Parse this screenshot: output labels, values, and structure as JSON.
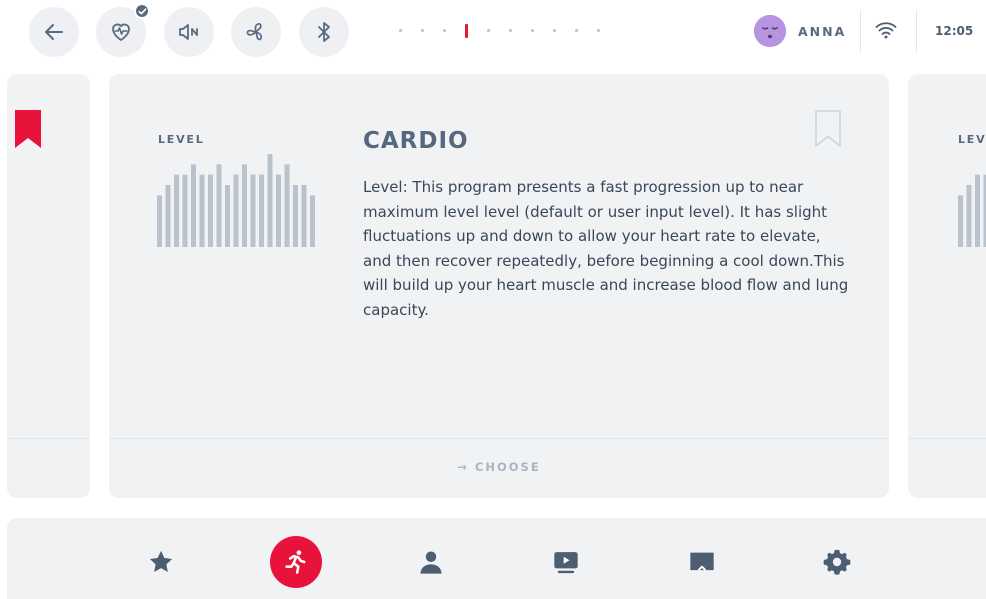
{
  "topbar": {
    "icons": [
      "back-arrow-icon",
      "heart-rate-icon",
      "sound-off-icon",
      "fan-icon",
      "bluetooth-icon"
    ],
    "heart_rate_connected": true,
    "page_indicator": {
      "total": 10,
      "current": 4
    },
    "user": {
      "name": "ANNA",
      "avatar": "sleepy-face-avatar"
    },
    "wifi": "wifi-icon",
    "time": "12:05"
  },
  "carousel": {
    "cards": [
      {
        "position": "previous",
        "bookmarked": true
      },
      {
        "position": "current",
        "bookmarked": false,
        "level_label": "LEVEL",
        "title": "CARDIO",
        "description": "Level: This program presents a fast progression up to near maximum level level (default or user input level). It has slight fluctuations up and down to allow your heart rate to elevate, and then recover repeatedly, before beginning a cool down.This will build up your heart muscle and increase blood flow and lung capacity.",
        "level_profile": [
          5,
          6,
          7,
          7,
          8,
          7,
          7,
          8,
          6,
          7,
          8,
          7,
          7,
          9,
          7,
          8,
          6,
          6,
          5
        ],
        "choose_label": "CHOOSE"
      },
      {
        "position": "next",
        "level_label": "LEVEL"
      }
    ]
  },
  "bottomnav": {
    "items": [
      "favorites-star-icon",
      "workout-runner-icon",
      "user-profile-icon",
      "video-play-icon",
      "cast-screen-icon",
      "settings-gear-icon"
    ],
    "active_index": 1
  },
  "colors": {
    "accent": "#e8133a",
    "text_slate": "#5a6b80",
    "card_bg": "#f1f2f4",
    "bar": "#b9c2cd"
  }
}
